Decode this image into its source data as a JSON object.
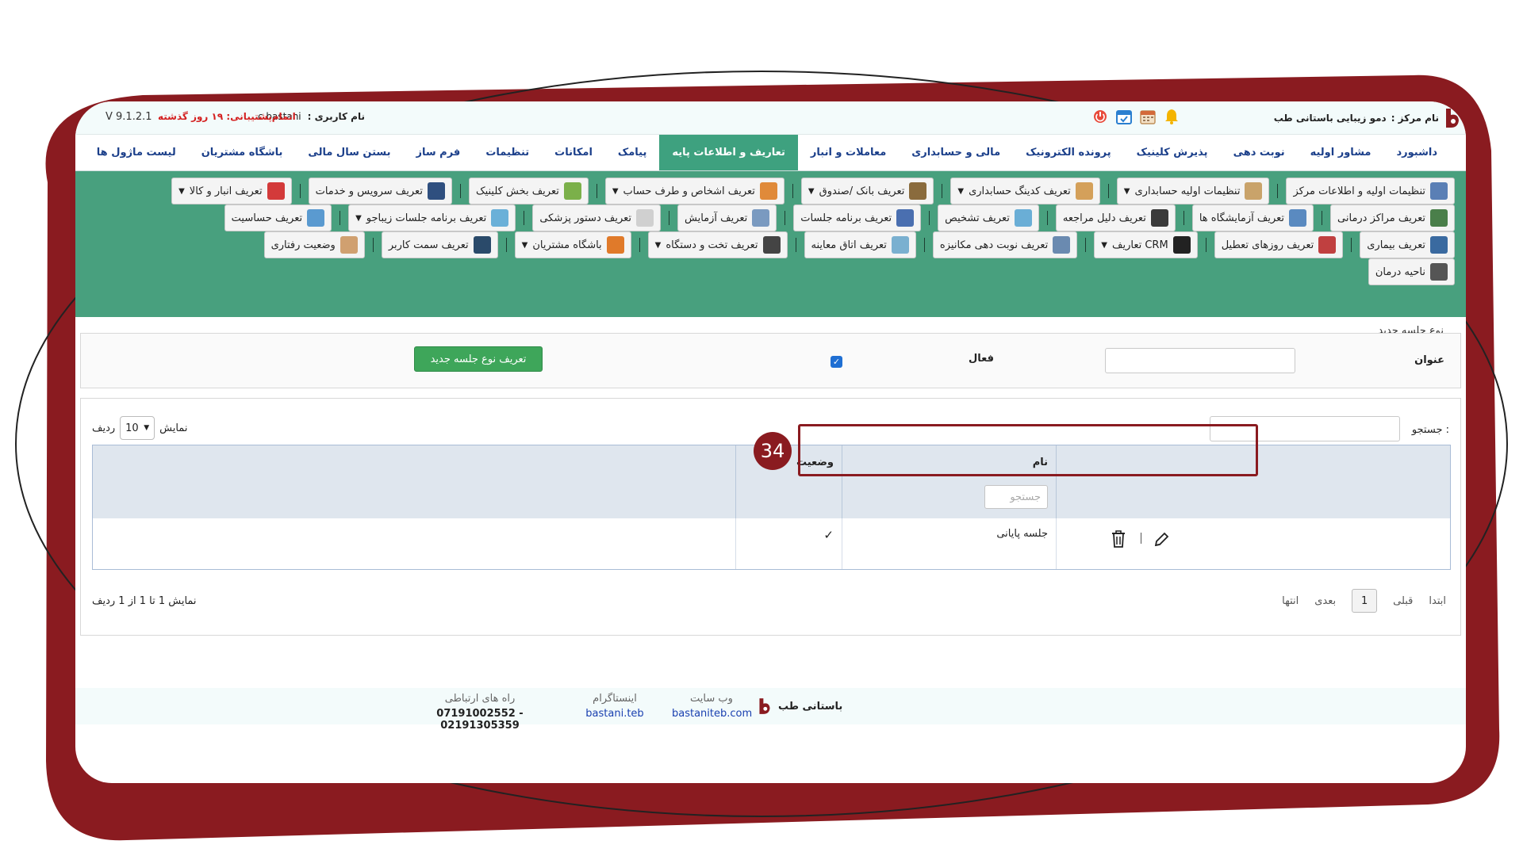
{
  "topbar": {
    "center_label": "نام مرکز :",
    "center_name": "دمو زیبایی باستانی طب",
    "user_label": "نام کاربری :",
    "user_name": "c.bastani",
    "support_text": "اتمام‌پشتیبانی: ۱۹ روز گذشته",
    "version": "V 9.1.2.1"
  },
  "mainnav": [
    {
      "label": "داشبورد",
      "active": false
    },
    {
      "label": "مشاور اولیه",
      "active": false
    },
    {
      "label": "نوبت دهی",
      "active": false
    },
    {
      "label": "پذیرش کلینیک",
      "active": false
    },
    {
      "label": "پرونده الکترونیک",
      "active": false
    },
    {
      "label": "مالی و حسابداری",
      "active": false
    },
    {
      "label": "معاملات و انبار",
      "active": false
    },
    {
      "label": "تعاریف و اطلاعات پایه",
      "active": true
    },
    {
      "label": "پیامک",
      "active": false
    },
    {
      "label": "امکانات",
      "active": false
    },
    {
      "label": "تنظیمات",
      "active": false
    },
    {
      "label": "فرم ساز",
      "active": false
    },
    {
      "label": "بستن سال مالی",
      "active": false
    },
    {
      "label": "باشگاه مشتریان",
      "active": false
    },
    {
      "label": "لیست ماژول ها",
      "active": false
    }
  ],
  "toolbar": {
    "row1": [
      {
        "label": "تنظیمات اولیه و اطلاعات مرکز",
        "caret": false,
        "color": "#5a7fb5"
      },
      {
        "label": "تنظیمات اولیه حسابداری",
        "caret": true,
        "color": "#c9a36a"
      },
      {
        "label": "تعریف کدینگ حسابداری",
        "caret": true,
        "color": "#d4a05a"
      },
      {
        "label": "تعریف بانک /صندوق",
        "caret": true,
        "color": "#8a6b3d"
      },
      {
        "label": "تعریف اشخاص و طرف حساب",
        "caret": true,
        "color": "#e08a3a"
      },
      {
        "label": "تعریف بخش کلینیک",
        "caret": false,
        "color": "#7bb04a"
      },
      {
        "label": "تعریف سرویس و خدمات",
        "caret": false,
        "color": "#2f4f7f"
      },
      {
        "label": "تعریف انبار و کالا",
        "caret": true,
        "color": "#d33a3a"
      }
    ],
    "row2": [
      {
        "label": "تعریف مراکز درمانی",
        "caret": false,
        "color": "#4a7f4a"
      },
      {
        "label": "تعریف آزمایشگاه ها",
        "caret": false,
        "color": "#5a8ac0"
      },
      {
        "label": "تعریف دلیل مراجعه",
        "caret": false,
        "color": "#3a3a3a"
      },
      {
        "label": "تعریف تشخیص",
        "caret": false,
        "color": "#6aaed6"
      },
      {
        "label": "تعریف برنامه جلسات",
        "caret": false,
        "color": "#4a6fb0"
      },
      {
        "label": "تعریف آزمایش",
        "caret": false,
        "color": "#7a9ac0"
      },
      {
        "label": "تعریف دستور پزشکی",
        "caret": false,
        "color": "#d0d0d0"
      },
      {
        "label": "تعریف برنامه جلسات زیباجو",
        "caret": true,
        "color": "#6ab0d8"
      },
      {
        "label": "تعریف حساسیت",
        "caret": false,
        "color": "#5a9ad0"
      }
    ],
    "row3": [
      {
        "label": "تعریف بیماری",
        "caret": false,
        "color": "#3a6aa0"
      },
      {
        "label": "تعریف روزهای تعطیل",
        "caret": false,
        "color": "#c04040"
      },
      {
        "label": "تعاریف CRM",
        "caret": true,
        "color": "#222222"
      },
      {
        "label": "تعریف نوبت دهی مکانیزه",
        "caret": false,
        "color": "#6a8ab0"
      },
      {
        "label": "تعریف اتاق معاینه",
        "caret": false,
        "color": "#7ab0d0"
      },
      {
        "label": "تعریف تخت و دستگاه",
        "caret": true,
        "color": "#444444"
      },
      {
        "label": "باشگاه مشتریان",
        "caret": true,
        "color": "#e07a2a"
      },
      {
        "label": "تعریف سمت کاربر",
        "caret": false,
        "color": "#2a4a6a"
      },
      {
        "label": "وضعیت رفتاری",
        "caret": false,
        "color": "#d0a070"
      }
    ],
    "row4": [
      {
        "label": "ناحیه درمان",
        "caret": false,
        "color": "#555555"
      }
    ]
  },
  "form": {
    "section_title": "نوع جلسه جدید",
    "title_label": "عنوان",
    "active_label": "فعال",
    "active_checked_glyph": "✓",
    "submit_label": "تعریف نوع جلسه جدید"
  },
  "table": {
    "search_label": "جستجو :",
    "show_before": "نمایش",
    "show_value": "10",
    "show_after": "ردیف",
    "columns": [
      "نام",
      "وضعیت"
    ],
    "filter_placeholder": "جستجو",
    "rows": [
      {
        "name": "جلسه پایانی",
        "status": "✓"
      }
    ],
    "info": "نمایش 1 تا 1 از 1 ردیف",
    "pager": {
      "first": "ابتدا",
      "prev": "قبلی",
      "current": "1",
      "next": "بعدی",
      "last": "انتها"
    }
  },
  "annotation": {
    "badge": "34",
    "color": "#8a1b20"
  },
  "footer": {
    "brand": "باستانی طب",
    "website_title": "وب سایت",
    "website_value": "bastaniteb.com",
    "instagram_title": "اینستاگرام",
    "instagram_value": "bastani.teb",
    "contact_title": "راه های ارتباطی",
    "contact_value": "07191002552 - 02191305359"
  },
  "colors": {
    "accent_green": "#48a07e",
    "nav_text": "#1b3f8a",
    "frame": "#8a1b20"
  }
}
